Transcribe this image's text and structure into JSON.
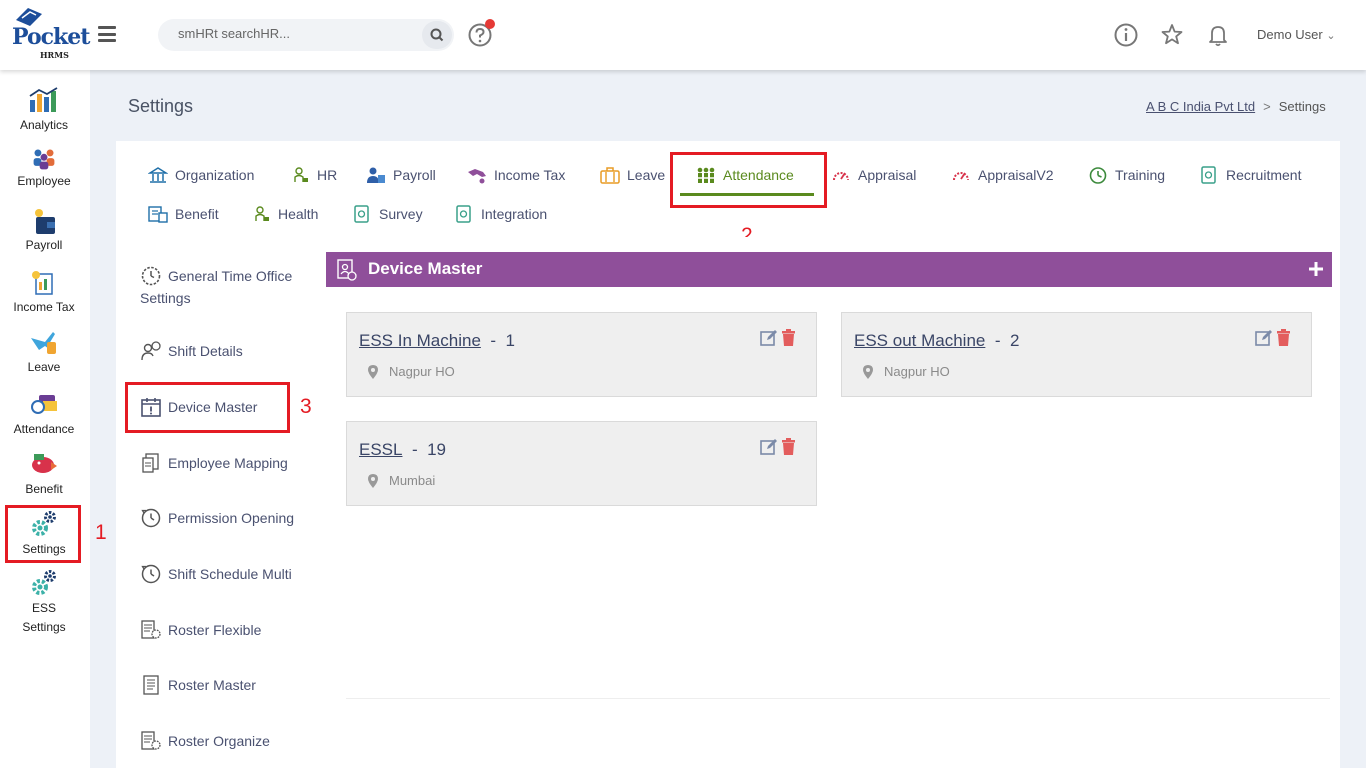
{
  "header": {
    "logo_word": "Pocket",
    "logo_sub": "HRMS",
    "search_placeholder": "smHRt searchHR...",
    "user_name": "Demo User",
    "user_caret": "⌄"
  },
  "sidebar": {
    "items": [
      {
        "label": "Analytics",
        "icon": "analytics-icon"
      },
      {
        "label": "Employee",
        "icon": "employee-icon"
      },
      {
        "label": "Payroll",
        "icon": "payroll-icon"
      },
      {
        "label": "Income Tax",
        "icon": "income-tax-icon"
      },
      {
        "label": "Leave",
        "icon": "leave-icon"
      },
      {
        "label": "Attendance",
        "icon": "attendance-icon"
      },
      {
        "label": "Benefit",
        "icon": "benefit-icon"
      },
      {
        "label": "Settings",
        "icon": "settings-icon"
      },
      {
        "label": "ESS",
        "label2": "Settings",
        "icon": "ess-settings-icon"
      }
    ]
  },
  "page": {
    "title": "Settings",
    "breadcrumb_company": "A B C India Pvt Ltd",
    "breadcrumb_sep": ">",
    "breadcrumb_current": "Settings"
  },
  "tabs": [
    {
      "label": "Organization"
    },
    {
      "label": "HR"
    },
    {
      "label": "Payroll"
    },
    {
      "label": "Income Tax"
    },
    {
      "label": "Leave"
    },
    {
      "label": "Attendance",
      "active": true
    },
    {
      "label": "Appraisal"
    },
    {
      "label": "AppraisalV2"
    },
    {
      "label": "Training"
    },
    {
      "label": "Recruitment"
    },
    {
      "label": "Benefit"
    },
    {
      "label": "Health"
    },
    {
      "label": "Survey"
    },
    {
      "label": "Integration"
    }
  ],
  "submenu": [
    {
      "label": "General Time Office",
      "label2": "Settings"
    },
    {
      "label": "Shift Details"
    },
    {
      "label": "Device Master"
    },
    {
      "label": "Employee Mapping"
    },
    {
      "label": "Permission Opening"
    },
    {
      "label": "Shift Schedule Multi"
    },
    {
      "label": "Roster Flexible"
    },
    {
      "label": "Roster Master"
    },
    {
      "label": "Roster Organize"
    }
  ],
  "panel": {
    "title": "Device Master",
    "devices": [
      {
        "name": "ESS In Machine",
        "sep": "-",
        "id": "1",
        "location": "Nagpur HO"
      },
      {
        "name": "ESS out Machine",
        "sep": "-",
        "id": "2",
        "location": "Nagpur HO"
      },
      {
        "name": "ESSL",
        "sep": "-",
        "id": "19",
        "location": "Mumbai"
      }
    ]
  },
  "annotations": {
    "n1": "1",
    "n2": "2",
    "n3": "3"
  },
  "colors": {
    "accent_purple": "#8f4f9a",
    "active_green": "#5a8a1e",
    "annotation_red": "#e41b23"
  }
}
